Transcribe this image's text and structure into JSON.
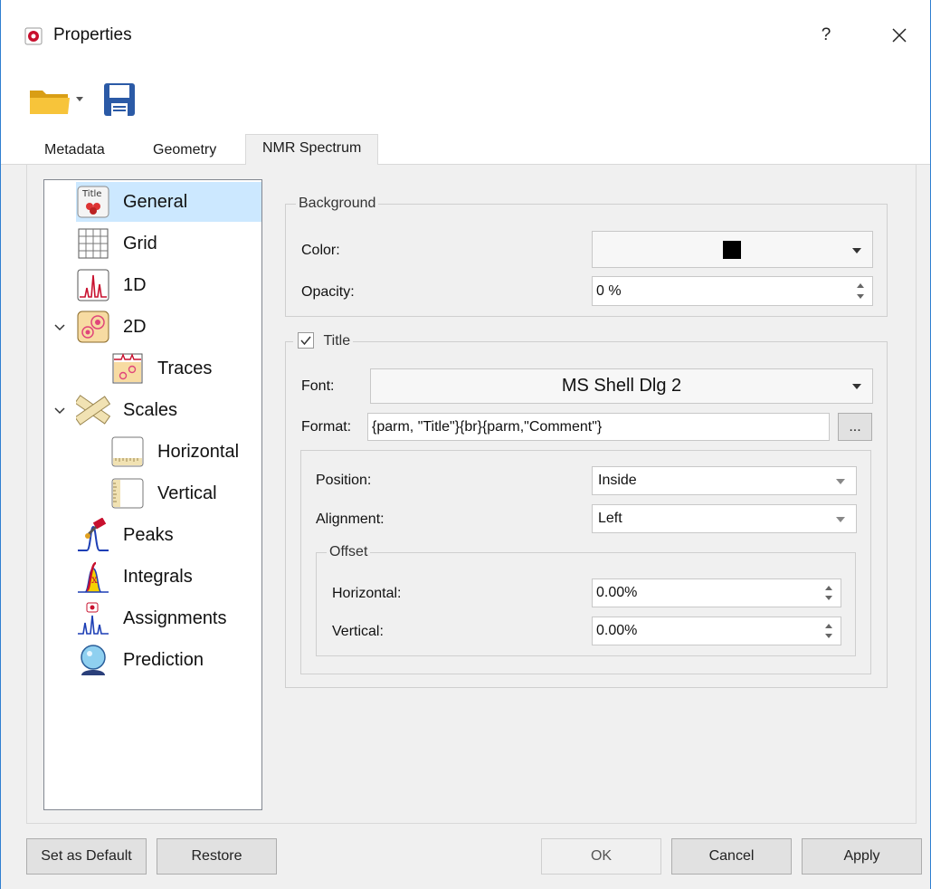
{
  "window": {
    "title": "Properties",
    "help_label": "?",
    "close_icon": "close-icon",
    "app_icon": "app-logo-icon"
  },
  "toolbar": {
    "open_icon": "folder-open-icon",
    "dropdown_icon": "chevron-down-icon",
    "save_icon": "floppy-disk-icon"
  },
  "tabs": [
    {
      "label": "Metadata",
      "active": false
    },
    {
      "label": "Geometry",
      "active": false
    },
    {
      "label": "NMR Spectrum",
      "active": true
    }
  ],
  "tree": {
    "items": [
      {
        "label": "General",
        "icon": "title-general-icon",
        "selected": true
      },
      {
        "label": "Grid",
        "icon": "grid-icon"
      },
      {
        "label": "1D",
        "icon": "spectrum-1d-icon"
      },
      {
        "label": "2D",
        "icon": "spectrum-2d-icon",
        "expandable": true
      },
      {
        "label": "Traces",
        "icon": "traces-icon"
      },
      {
        "label": "Scales",
        "icon": "ruler-scales-icon",
        "expandable": true
      },
      {
        "label": "Horizontal",
        "icon": "horizontal-scale-icon"
      },
      {
        "label": "Vertical",
        "icon": "vertical-scale-icon"
      },
      {
        "label": "Peaks",
        "icon": "peaks-icon"
      },
      {
        "label": "Integrals",
        "icon": "integrals-icon"
      },
      {
        "label": "Assignments",
        "icon": "assignments-icon"
      },
      {
        "label": "Prediction",
        "icon": "prediction-icon"
      }
    ]
  },
  "background": {
    "group_label": "Background",
    "color_label": "Color:",
    "color_value": "#000000",
    "opacity_label": "Opacity:",
    "opacity_value": "0 %"
  },
  "title_group": {
    "label": "Title",
    "checked": true,
    "font_label": "Font:",
    "font_value": "MS Shell Dlg 2",
    "format_label": "Format:",
    "format_value": "{parm, \"Title\"}{br}{parm,\"Comment\"}",
    "ellipsis_label": "...",
    "position_label": "Position:",
    "position_value": "Inside",
    "alignment_label": "Alignment:",
    "alignment_value": "Left",
    "offset_label": "Offset",
    "horizontal_label": "Horizontal:",
    "horizontal_value": "0.00%",
    "vertical_label": "Vertical:",
    "vertical_value": "0.00%"
  },
  "footer": {
    "set_default_label": "Set as Default",
    "restore_label": "Restore",
    "ok_label": "OK",
    "cancel_label": "Cancel",
    "apply_label": "Apply"
  }
}
